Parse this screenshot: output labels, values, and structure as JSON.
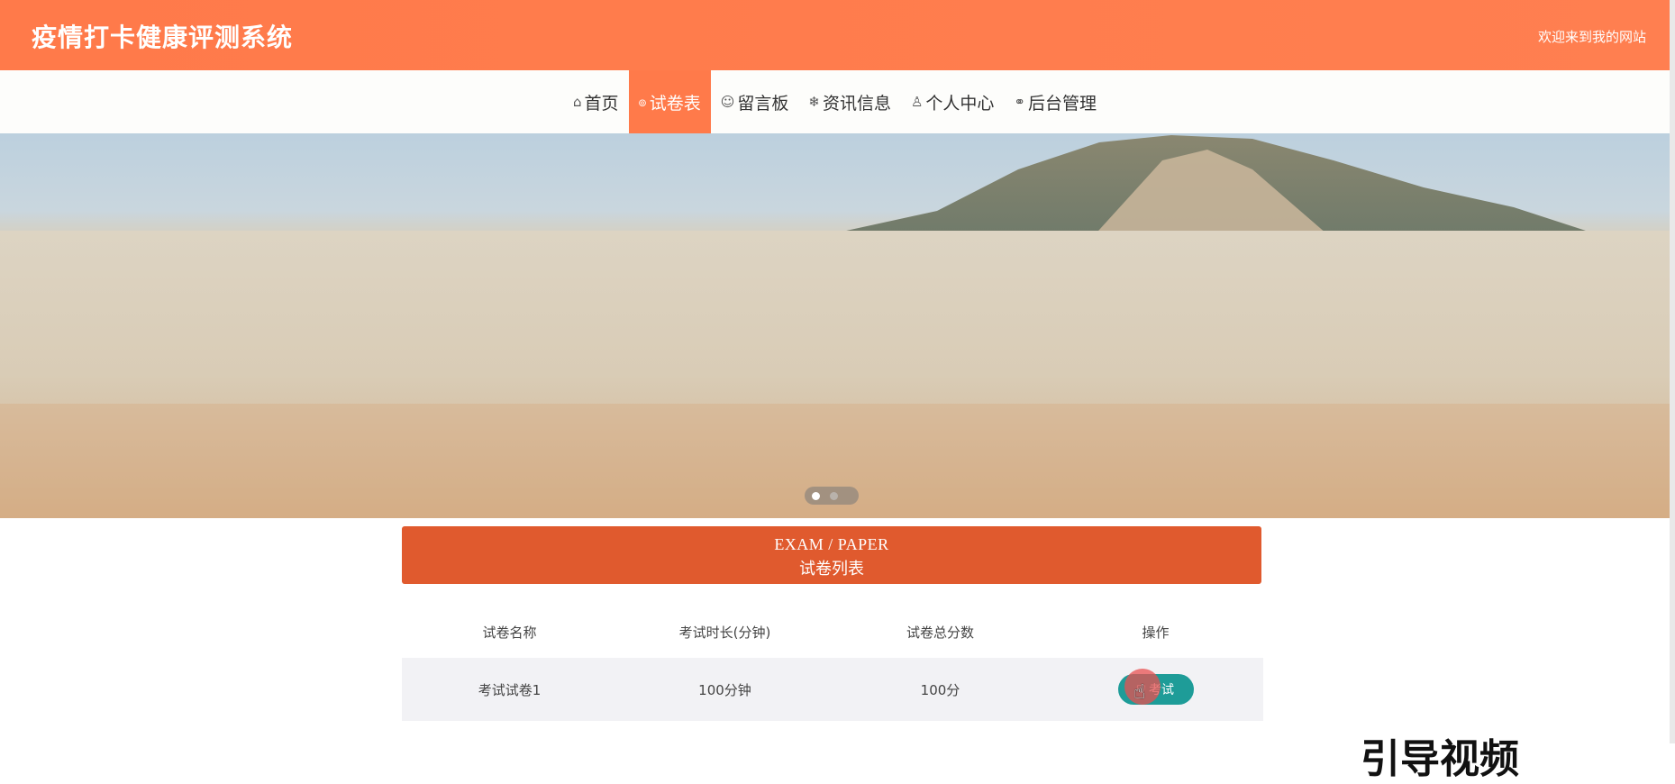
{
  "header": {
    "title": "疫情打卡健康评测系统",
    "welcome": "欢迎来到我的网站",
    "bg_color": "#ff7a4a"
  },
  "nav": {
    "items": [
      {
        "icon": "home-icon",
        "glyph": "⌂",
        "label": "首页"
      },
      {
        "icon": "paper-icon",
        "glyph": "๏",
        "label": "试卷表"
      },
      {
        "icon": "message-icon",
        "glyph": "☺",
        "label": "留言板"
      },
      {
        "icon": "snowflake-icon",
        "glyph": "❄",
        "label": "资讯信息"
      },
      {
        "icon": "person-icon",
        "glyph": "♙",
        "label": "个人中心"
      },
      {
        "icon": "link-icon",
        "glyph": "⚭",
        "label": "后台管理"
      }
    ],
    "active_index": 1,
    "active_color": "#ff7a4a"
  },
  "banner": {
    "carousel": {
      "slides": 2,
      "active": 1
    }
  },
  "section": {
    "title_en": "EXAM / PAPER",
    "title_cn": "试卷列表",
    "color": "#e05a2e"
  },
  "table": {
    "columns": [
      "试卷名称",
      "考试时长(分钟)",
      "试卷总分数",
      "操作"
    ],
    "rows": [
      {
        "name": "考试试卷1",
        "duration": "100分钟",
        "score": "100分",
        "action_label": "考试"
      }
    ],
    "button_color": "#1e9c98"
  },
  "watermark": {
    "text": "引导视频"
  }
}
